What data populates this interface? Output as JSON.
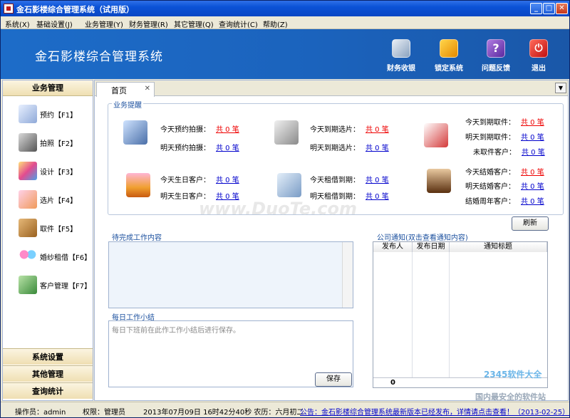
{
  "window": {
    "title": "金石影楼综合管理系统（试用版）"
  },
  "menu": [
    "系统(X)",
    "基础设置(J)",
    "业务管理(Y)",
    "财务管理(R)",
    "其它管理(Q)",
    "查询统计(C)",
    "帮助(Z)"
  ],
  "header": {
    "app_title": "金石影楼综合管理系统"
  },
  "toolbar": [
    {
      "label": "财务收银",
      "icon": "money-icon"
    },
    {
      "label": "锁定系统",
      "icon": "lock-icon"
    },
    {
      "label": "问题反馈",
      "icon": "question-icon"
    },
    {
      "label": "退出",
      "icon": "power-icon"
    }
  ],
  "sidebar": {
    "header": "业务管理",
    "items": [
      {
        "label": "预约【F1】",
        "icon": "appointment-icon"
      },
      {
        "label": "拍照【F2】",
        "icon": "camera-icon"
      },
      {
        "label": "设计【F3】",
        "icon": "design-icon"
      },
      {
        "label": "选片【F4】",
        "icon": "photo-select-icon"
      },
      {
        "label": "取件【F5】",
        "icon": "package-icon"
      },
      {
        "label": "婚纱租借【F6】",
        "icon": "dress-rental-icon"
      },
      {
        "label": "客户管理【F7】",
        "icon": "customer-icon"
      }
    ],
    "footer": [
      "系统设置",
      "其他管理",
      "查询统计"
    ]
  },
  "tabs": [
    {
      "label": "首页",
      "close": "✕"
    }
  ],
  "reminders": {
    "title": "业务提醒",
    "groups": [
      {
        "icon": "camera-icon",
        "items": [
          {
            "label": "今天预约拍摄：",
            "value": "共 0 笔",
            "red": true
          },
          {
            "label": "明天预约拍摄：",
            "value": "共 0 笔",
            "red": false
          }
        ]
      },
      {
        "icon": "photos-icon",
        "items": [
          {
            "label": "今天到期选片：",
            "value": "共 0 笔",
            "red": true
          },
          {
            "label": "明天到期选片：",
            "value": "共 0 笔",
            "red": false
          }
        ]
      },
      {
        "icon": "pickup-icon",
        "items": [
          {
            "label": "今天到期取件：",
            "value": "共 0 笔",
            "red": true
          },
          {
            "label": "明天到期取件：",
            "value": "共 0 笔",
            "red": false
          },
          {
            "label": "未取件客户：",
            "value": "共 0 笔",
            "red": false
          }
        ]
      },
      {
        "icon": "cake-icon",
        "items": [
          {
            "label": "今天生日客户：",
            "value": "共 0 笔",
            "red": false
          },
          {
            "label": "明天生日客户：",
            "value": "共 0 笔",
            "red": false
          }
        ]
      },
      {
        "icon": "rental-icon",
        "items": [
          {
            "label": "今天租借到期：",
            "value": "共 0 笔",
            "red": false
          },
          {
            "label": "明天租借到期：",
            "value": "共 0 笔",
            "red": false
          }
        ]
      },
      {
        "icon": "bride-icon",
        "items": [
          {
            "label": "今天结婚客户：",
            "value": "共 0 笔",
            "red": true
          },
          {
            "label": "明天结婚客户：",
            "value": "共 0 笔",
            "red": false
          },
          {
            "label": "结婚周年客户：",
            "value": "共 0 笔",
            "red": false
          }
        ]
      }
    ],
    "refresh_label": "刷新"
  },
  "pending": {
    "title": "待完成工作内容",
    "value": ""
  },
  "summary": {
    "title": "每日工作小结",
    "placeholder": "每日下班前在此作工作小结后进行保存。",
    "save_label": "保存"
  },
  "notice": {
    "title": "公司通知",
    "hint": "(双击查看通知内容)",
    "columns": [
      "发布人",
      "发布日期",
      "通知标题"
    ],
    "count": "0"
  },
  "status": {
    "operator": "操作员：admin",
    "permission": "权限：管理员",
    "datetime": "2013年07月09日  16时42分40秒  农历：六月初二",
    "announcement": "公告：金石影楼综合管理系统最新版本已经发布，详情请点击查看！（2013-02-25）"
  },
  "watermarks": [
    "www.DuoTe.com",
    "2345软件大全",
    "国内最安全的软件站"
  ]
}
